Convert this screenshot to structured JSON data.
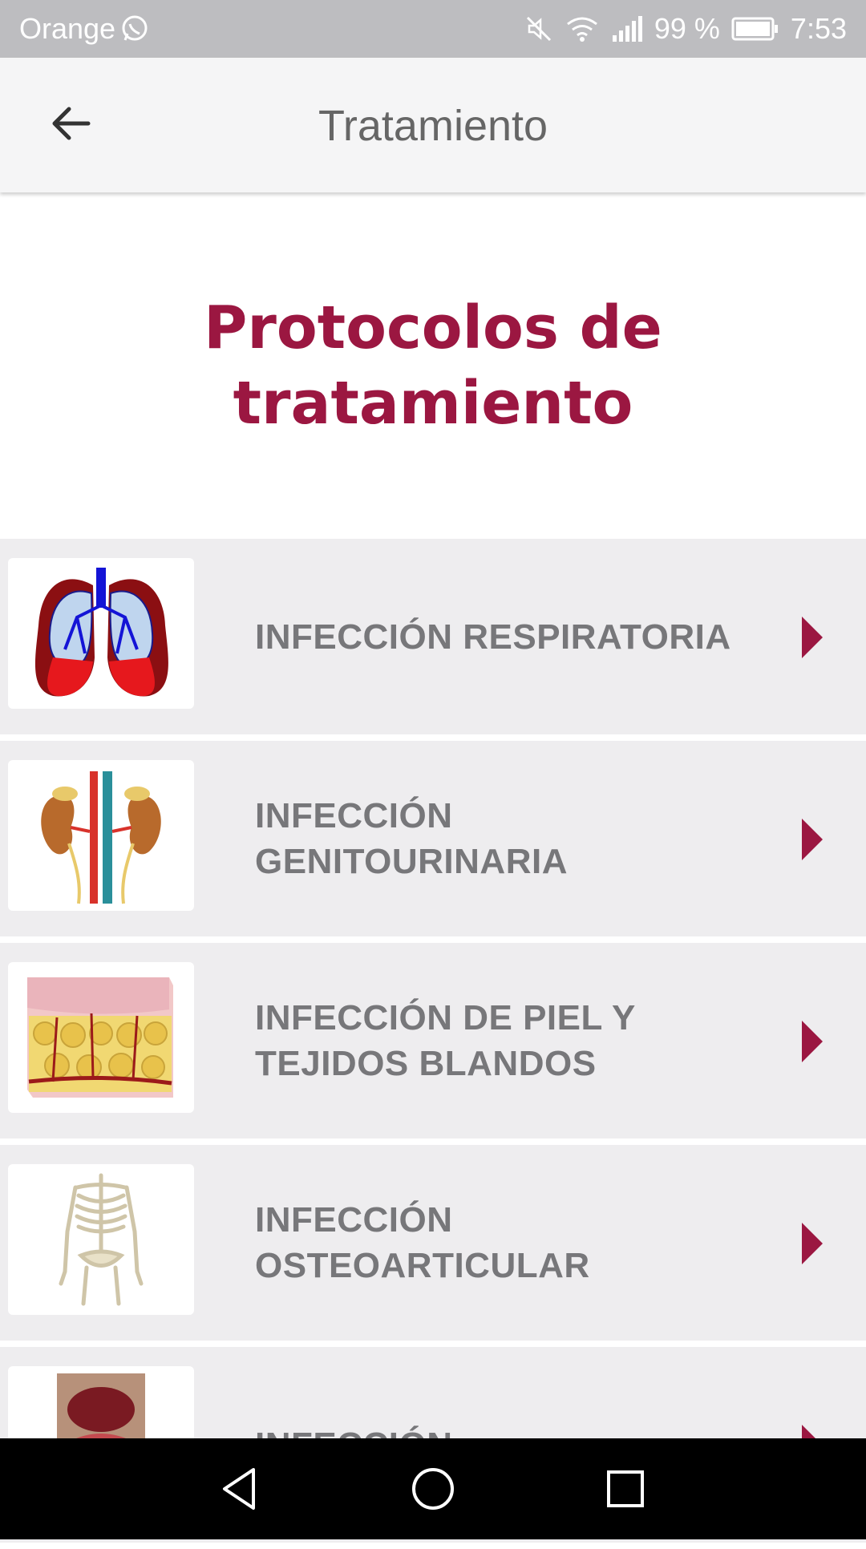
{
  "status_bar": {
    "carrier": "Orange",
    "battery": "99 %",
    "time": "7:53",
    "icons": [
      "whatsapp-icon",
      "mute-icon",
      "wifi-icon",
      "signal-icon",
      "battery-icon"
    ]
  },
  "app_bar": {
    "back_icon": "arrow-back-icon",
    "title": "Tratamiento"
  },
  "hero": {
    "title": "Protocolos de tratamiento",
    "color": "#9b1741"
  },
  "list": {
    "items": [
      {
        "label": "INFECCIÓN RESPIRATORIA",
        "image": "lungs-illustration"
      },
      {
        "label": "INFECCIÓN GENITOURINARIA",
        "image": "kidneys-illustration"
      },
      {
        "label": "INFECCIÓN DE PIEL Y TEJIDOS BLANDOS",
        "image": "skin-tissue-illustration"
      },
      {
        "label": "INFECCIÓN OSTEOARTICULAR",
        "image": "skeleton-illustration"
      },
      {
        "label": "INFECCIÓN",
        "image": "abdomen-illustration"
      }
    ],
    "chevron_icon": "chevron-right-icon",
    "accent": "#9b1741"
  },
  "nav_bar": {
    "back": "nav-back-icon",
    "home": "nav-home-icon",
    "recents": "nav-recents-icon"
  }
}
